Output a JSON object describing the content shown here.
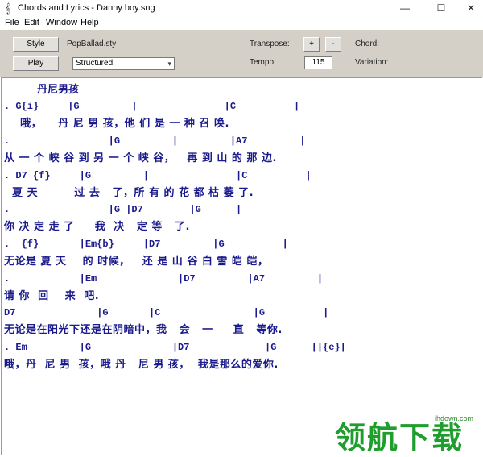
{
  "window": {
    "title": "Chords and Lyrics - Danny boy.sng",
    "minimize": "—",
    "maximize": "☐",
    "close": "✕",
    "app_icon": "𝄞"
  },
  "menu": [
    "File",
    "Edit",
    "Window",
    "Help"
  ],
  "toolbar": {
    "style_button": "Style",
    "style_file": "PopBallad.sty",
    "play_button": "Play",
    "mode_select": "Structured",
    "transpose_label": "Transpose:",
    "transpose_plus": "+",
    "transpose_minus": "-",
    "chord_label": "Chord:",
    "tempo_label": "Tempo:",
    "tempo_value": "115",
    "variation_label": "Variation:"
  },
  "song": {
    "title": "丹尼男孩",
    "lines": [
      {
        "type": "chord",
        "text": ". G{i}     |G         |               |C          |"
      },
      {
        "type": "lyric",
        "text": "    哦，    丹 尼 男 孩，他 们 是 一 种 召 唤."
      },
      {
        "type": "chord",
        "text": ".                 |G         |         |A7         |"
      },
      {
        "type": "lyric",
        "text": "从 一 个 峡 谷 到 另 一 个 峡 谷，   再 到 山 的 那 边."
      },
      {
        "type": "chord",
        "text": ". D7 {f}     |G         |               |C          |"
      },
      {
        "type": "lyric",
        "text": "  夏 天         过 去   了，所 有 的 花 都 枯 萎 了."
      },
      {
        "type": "chord",
        "text": ".                 |G |D7        |G      |"
      },
      {
        "type": "lyric",
        "text": "你 决 定 走 了     我  决   定 等   了."
      },
      {
        "type": "chord",
        "text": ".  {f}       |Em{b}     |D7         |G          |"
      },
      {
        "type": "lyric",
        "text": "无论是 夏 天    的 时候，   还 是 山 谷 白 雪 皑 皑，"
      },
      {
        "type": "chord",
        "text": ".            |Em              |D7         |A7         |"
      },
      {
        "type": "lyric",
        "text": "请 你  回    来  吧."
      },
      {
        "type": "chord",
        "text": "D7              |G       |C                |G          |"
      },
      {
        "type": "lyric",
        "text": "无论是在阳光下还是在阴暗中，我   会   一     直   等你."
      },
      {
        "type": "chord",
        "text": ". Em         |G              |D7             |G      ||{e}|"
      },
      {
        "type": "lyric",
        "text": "哦，丹  尼 男  孩，哦 丹   尼 男 孩，  我是那么的爱你."
      }
    ]
  },
  "watermark": {
    "text": "领航下载",
    "url": "ihdown.com"
  }
}
